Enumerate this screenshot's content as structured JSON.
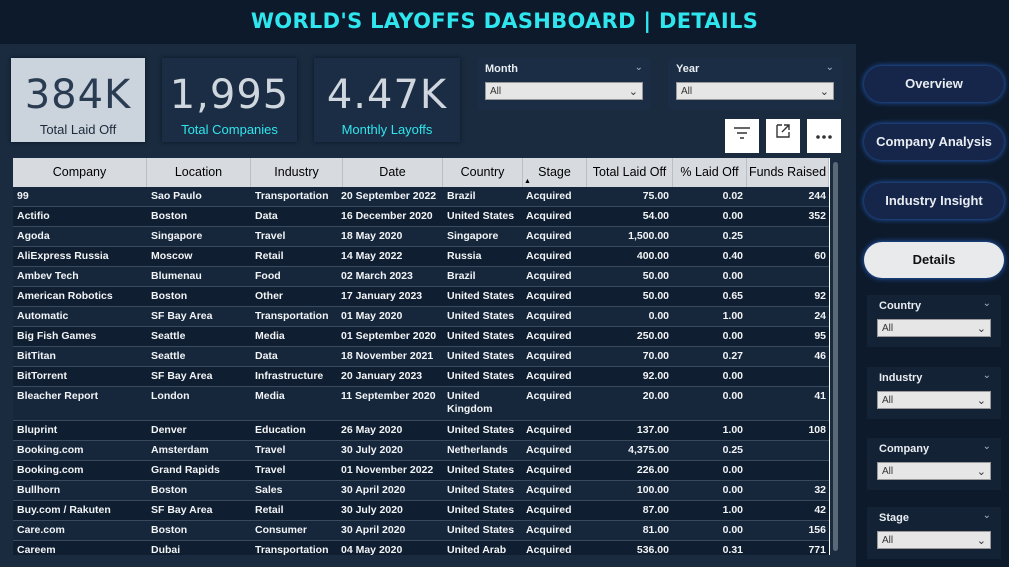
{
  "header": {
    "title": "WORLD'S LAYOFFS DASHBOARD | DETAILS"
  },
  "kpis": [
    {
      "value": "384K",
      "label": "Total Laid Off"
    },
    {
      "value": "1,995",
      "label": "Total Companies"
    },
    {
      "value": "4.47K",
      "label": "Monthly Layoffs"
    }
  ],
  "filters": {
    "month": {
      "label": "Month",
      "value": "All"
    },
    "year": {
      "label": "Year",
      "value": "All"
    }
  },
  "toolbar": {
    "icons": [
      "filter-icon",
      "focus-mode-icon",
      "more-options-icon"
    ]
  },
  "table": {
    "columns": [
      "Company",
      "Location",
      "Industry",
      "Date",
      "Country",
      "Stage",
      "Total Laid Off",
      "% Laid Off",
      "Funds Raised"
    ],
    "sorted_column": "Stage",
    "rows": [
      [
        "99",
        "Sao Paulo",
        "Transportation",
        "20 September 2022",
        "Brazil",
        "Acquired",
        "75.00",
        "0.02",
        "244"
      ],
      [
        "Actifio",
        "Boston",
        "Data",
        "16 December 2020",
        "United States",
        "Acquired",
        "54.00",
        "0.00",
        "352"
      ],
      [
        "Agoda",
        "Singapore",
        "Travel",
        "18 May 2020",
        "Singapore",
        "Acquired",
        "1,500.00",
        "0.25",
        ""
      ],
      [
        "AliExpress Russia",
        "Moscow",
        "Retail",
        "14 May 2022",
        "Russia",
        "Acquired",
        "400.00",
        "0.40",
        "60"
      ],
      [
        "Ambev Tech",
        "Blumenau",
        "Food",
        "02 March 2023",
        "Brazil",
        "Acquired",
        "50.00",
        "0.00",
        ""
      ],
      [
        "American Robotics",
        "Boston",
        "Other",
        "17 January 2023",
        "United States",
        "Acquired",
        "50.00",
        "0.65",
        "92"
      ],
      [
        "Automatic",
        "SF Bay Area",
        "Transportation",
        "01 May 2020",
        "United States",
        "Acquired",
        "0.00",
        "1.00",
        "24"
      ],
      [
        "Big Fish Games",
        "Seattle",
        "Media",
        "01 September 2020",
        "United States",
        "Acquired",
        "250.00",
        "0.00",
        "95"
      ],
      [
        "BitTitan",
        "Seattle",
        "Data",
        "18 November 2021",
        "United States",
        "Acquired",
        "70.00",
        "0.27",
        "46"
      ],
      [
        "BitTorrent",
        "SF Bay Area",
        "Infrastructure",
        "20 January 2023",
        "United States",
        "Acquired",
        "92.00",
        "0.00",
        ""
      ],
      [
        "Bleacher Report",
        "London",
        "Media",
        "11 September 2020",
        "United Kingdom",
        "Acquired",
        "20.00",
        "0.00",
        "41"
      ],
      [
        "Bluprint",
        "Denver",
        "Education",
        "26 May 2020",
        "United States",
        "Acquired",
        "137.00",
        "1.00",
        "108"
      ],
      [
        "Booking.com",
        "Amsterdam",
        "Travel",
        "30 July 2020",
        "Netherlands",
        "Acquired",
        "4,375.00",
        "0.25",
        ""
      ],
      [
        "Booking.com",
        "Grand Rapids",
        "Travel",
        "01 November 2022",
        "United States",
        "Acquired",
        "226.00",
        "0.00",
        ""
      ],
      [
        "Bullhorn",
        "Boston",
        "Sales",
        "30 April 2020",
        "United States",
        "Acquired",
        "100.00",
        "0.00",
        "32"
      ],
      [
        "Buy.com / Rakuten",
        "SF Bay Area",
        "Retail",
        "30 July 2020",
        "United States",
        "Acquired",
        "87.00",
        "1.00",
        "42"
      ],
      [
        "Care.com",
        "Boston",
        "Consumer",
        "30 April 2020",
        "United States",
        "Acquired",
        "81.00",
        "0.00",
        "156"
      ],
      [
        "Careem",
        "Dubai",
        "Transportation",
        "04 May 2020",
        "United Arab",
        "Acquired",
        "536.00",
        "0.31",
        "771"
      ]
    ]
  },
  "nav": [
    "Overview",
    "Company Analysis",
    "Industry Insight",
    "Details"
  ],
  "nav_active": "Details",
  "side_filters": [
    {
      "label": "Country",
      "value": "All"
    },
    {
      "label": "Industry",
      "value": "All"
    },
    {
      "label": "Company",
      "value": "All"
    },
    {
      "label": "Stage",
      "value": "All"
    }
  ],
  "colors": {
    "accent": "#2fe6ee",
    "background": "#0c1a2b",
    "panel": "#1a2b40",
    "nav_glow": "#2b6bd6"
  }
}
